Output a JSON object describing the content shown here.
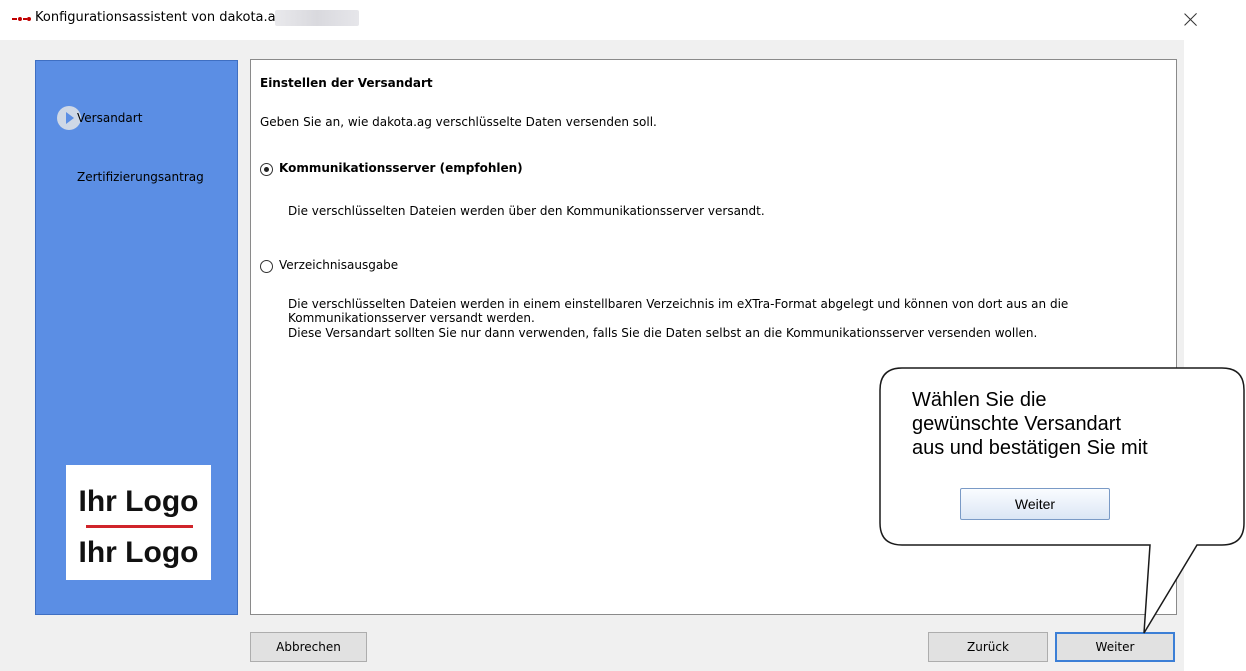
{
  "window": {
    "title": "Konfigurationsassistent von dakota.ag"
  },
  "sidebar": {
    "items": [
      {
        "label": "Versandart"
      },
      {
        "label": "Zertifizierungsantrag"
      }
    ],
    "logo": {
      "top_text": "Ihr Logo",
      "bottom_text": "Ihr Logo"
    }
  },
  "main": {
    "heading": "Einstellen der Versandart",
    "intro": "Geben Sie an, wie dakota.ag verschlüsselte Daten versenden soll.",
    "options": [
      {
        "label": "Kommunikationsserver (empfohlen)",
        "checked": true,
        "description": "Die verschlüsselten Dateien werden über den Kommunikationsserver versandt."
      },
      {
        "label": "Verzeichnisausgabe",
        "checked": false,
        "description_lines": [
          "Die verschlüsselten Dateien werden in einem einstellbaren Verzeichnis im eXTra-Format abgelegt und können von dort aus an die",
          "Kommunikationsserver versandt werden.",
          "Diese Versandart sollten Sie nur dann verwenden, falls Sie die Daten selbst an die Kommunikationsserver versenden wollen."
        ]
      }
    ]
  },
  "footer": {
    "cancel_label": "Abbrechen",
    "back_label": "Zurück",
    "next_label": "Weiter"
  },
  "callout": {
    "text": "Wählen Sie die\ngewünschte Versandart\naus und bestätigen Sie mit",
    "button_label": "Weiter"
  },
  "colors": {
    "sidebar": "#5b8ee4",
    "logo_line": "#d0242a",
    "primary_button_border": "#3c7fd6"
  },
  "icons": [
    "app-icon",
    "close-icon",
    "nav-arrow-icon",
    "radio-checked-icon",
    "radio-unchecked-icon"
  ]
}
